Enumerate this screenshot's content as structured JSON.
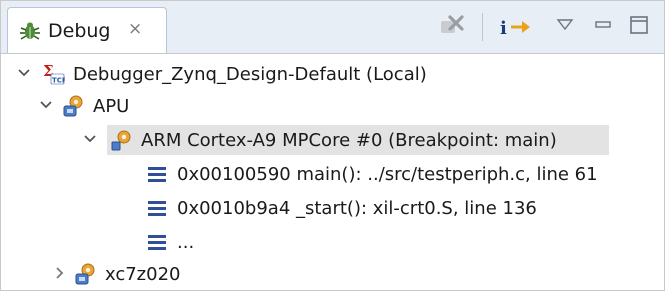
{
  "view": {
    "tab": {
      "label": "Debug",
      "close_icon": "close-icon",
      "icon": "debug-bug-icon"
    },
    "toolbar": {
      "buttons": [
        {
          "name": "remove-all-terminated-icon"
        },
        {
          "name": "step-into-instruction-icon"
        },
        {
          "name": "view-menu-icon"
        },
        {
          "name": "minimize-icon"
        },
        {
          "name": "maximize-icon"
        }
      ]
    }
  },
  "tree": {
    "launch": {
      "label": "Debugger_Zynq_Design-Default (Local)",
      "expanded": true
    },
    "apu": {
      "label": "APU",
      "expanded": true
    },
    "core": {
      "label": "ARM Cortex-A9 MPCore #0 (Breakpoint: main)",
      "expanded": true,
      "selected": true
    },
    "frames": [
      {
        "label": "0x00100590 main(): ../src/testperiph.c, line 61"
      },
      {
        "label": "0x0010b9a4 _start(): xil-crt0.S, line 136"
      },
      {
        "label": "..."
      }
    ],
    "device": {
      "label": "xc7z020",
      "expanded": false
    }
  },
  "colors": {
    "selection": "#e3e3e3",
    "frame_icon": "#2f4f9a"
  }
}
